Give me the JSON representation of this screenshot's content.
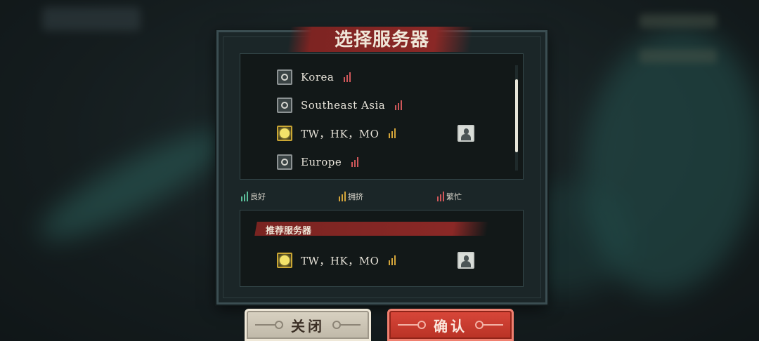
{
  "dialog": {
    "title": "选择服务器"
  },
  "servers": [
    {
      "name": "Korea",
      "selected": false,
      "status": "busy",
      "has_character": false
    },
    {
      "name": "Southeast Asia",
      "selected": false,
      "status": "busy",
      "has_character": false
    },
    {
      "name": "TW，HK，MO",
      "selected": true,
      "status": "crowded",
      "has_character": true
    },
    {
      "name": "Europe",
      "selected": false,
      "status": "busy",
      "has_character": false
    }
  ],
  "legend": {
    "good": "良好",
    "crowded": "拥挤",
    "busy": "繁忙"
  },
  "status_colors": {
    "good": "#5bbf9a",
    "crowded": "#d4a53a",
    "busy": "#d0575a"
  },
  "recommended": {
    "title": "推荐服务器",
    "server": {
      "name": "TW，HK，MO",
      "selected": true,
      "status": "crowded",
      "has_character": true
    }
  },
  "buttons": {
    "close_label": "关闭",
    "confirm_label": "确认"
  },
  "icons": {
    "radio": "radio-icon",
    "signal": "signal-bars-icon",
    "character": "character-avatar-icon"
  }
}
